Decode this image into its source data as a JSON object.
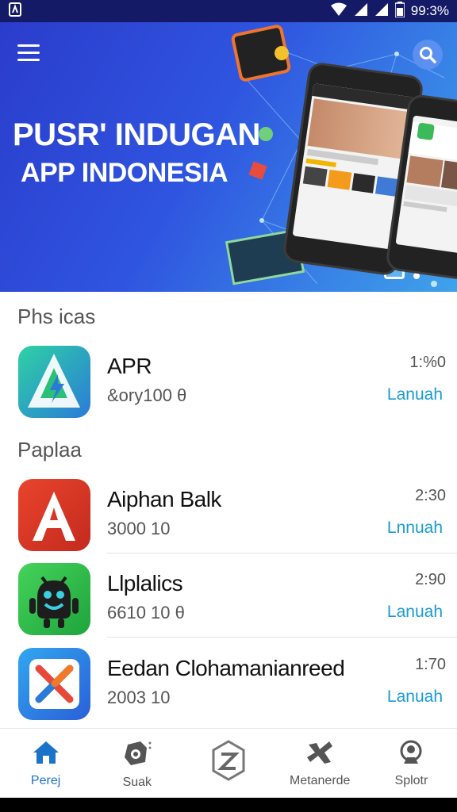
{
  "status_bar": {
    "time": "99:3%"
  },
  "hero": {
    "title_line1": "PUSR' INDUGAN",
    "title_line2": "APP INDONESIA"
  },
  "sections": [
    {
      "title": "Phs icas",
      "items": [
        {
          "name": "APR",
          "meta": "&ory100 θ",
          "size": "1:%0",
          "action": "Lanuah"
        }
      ]
    },
    {
      "title": "Paplaa",
      "items": [
        {
          "name": "Aiphan Balk",
          "meta": "3000 10",
          "size": "2:30",
          "action": "Lnnuah"
        },
        {
          "name": "Llplalics",
          "meta": "6610 10 θ",
          "size": "2:90",
          "action": "Lanuah"
        },
        {
          "name": "Eedan Clohamanianreed",
          "meta": "2003 10",
          "size": "1:70",
          "action": "Lanuah"
        }
      ]
    }
  ],
  "bottom_nav": [
    {
      "label": "Perej",
      "icon": "home-icon",
      "active": true
    },
    {
      "label": "Suak",
      "icon": "camera-icon",
      "active": false
    },
    {
      "label": "",
      "icon": "hexagon-logo-icon",
      "active": false
    },
    {
      "label": "Metanerde",
      "icon": "tools-icon",
      "active": false
    },
    {
      "label": "Splotr",
      "icon": "profile-icon",
      "active": false
    }
  ],
  "colors": {
    "accent": "#1a9bd2",
    "hero_start": "#2b3ccc",
    "hero_end": "#3fa3ea",
    "statusbar": "#141a66"
  }
}
